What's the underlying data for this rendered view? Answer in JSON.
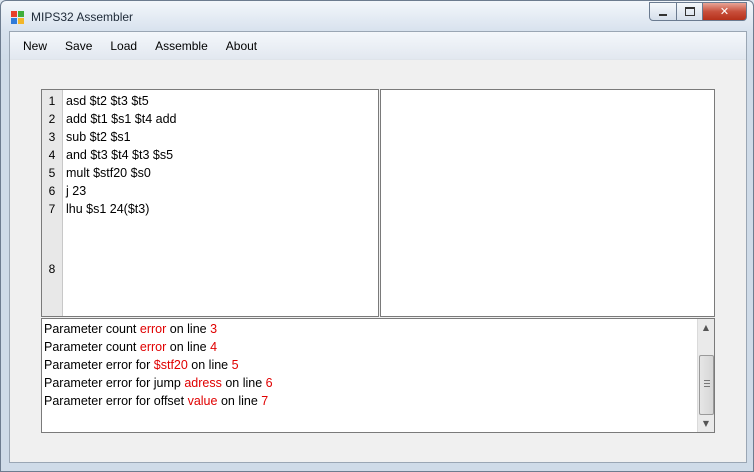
{
  "window": {
    "title": "MIPS32 Assembler",
    "colors": {
      "icon_a": "#e8402a",
      "icon_b": "#2f7ad8",
      "icon_c": "#f2b629",
      "icon_d": "#3fae3b"
    }
  },
  "menu": [
    "New",
    "Save",
    "Load",
    "Assemble",
    "About"
  ],
  "editor": {
    "line_numbers": [
      "1",
      "2",
      "3",
      "4",
      "5",
      "6",
      "7",
      "8"
    ],
    "lines": [
      "asd $t2 $t3 $t5",
      "add $t1 $s1 $t4 add",
      "sub $t2 $s1",
      "and $t3 $t4 $t3 $s5",
      "mult $stf20 $s0",
      "j 23",
      "lhu $s1 24($t3)"
    ]
  },
  "errors": [
    {
      "before": "Parameter count ",
      "highlight": "error",
      "middle": " on line ",
      "line": "3"
    },
    {
      "before": "Parameter count ",
      "highlight": "error",
      "middle": " on line ",
      "line": "4"
    },
    {
      "before": "Parameter error for ",
      "highlight": "$stf20",
      "middle": " on line ",
      "line": "5"
    },
    {
      "before": "Parameter error for jump ",
      "highlight": "adress",
      "middle": " on line ",
      "line": "6"
    },
    {
      "before": "Parameter error for offset ",
      "highlight": "value",
      "middle": " on line ",
      "line": "7"
    }
  ],
  "highlight_color": "#e00000"
}
